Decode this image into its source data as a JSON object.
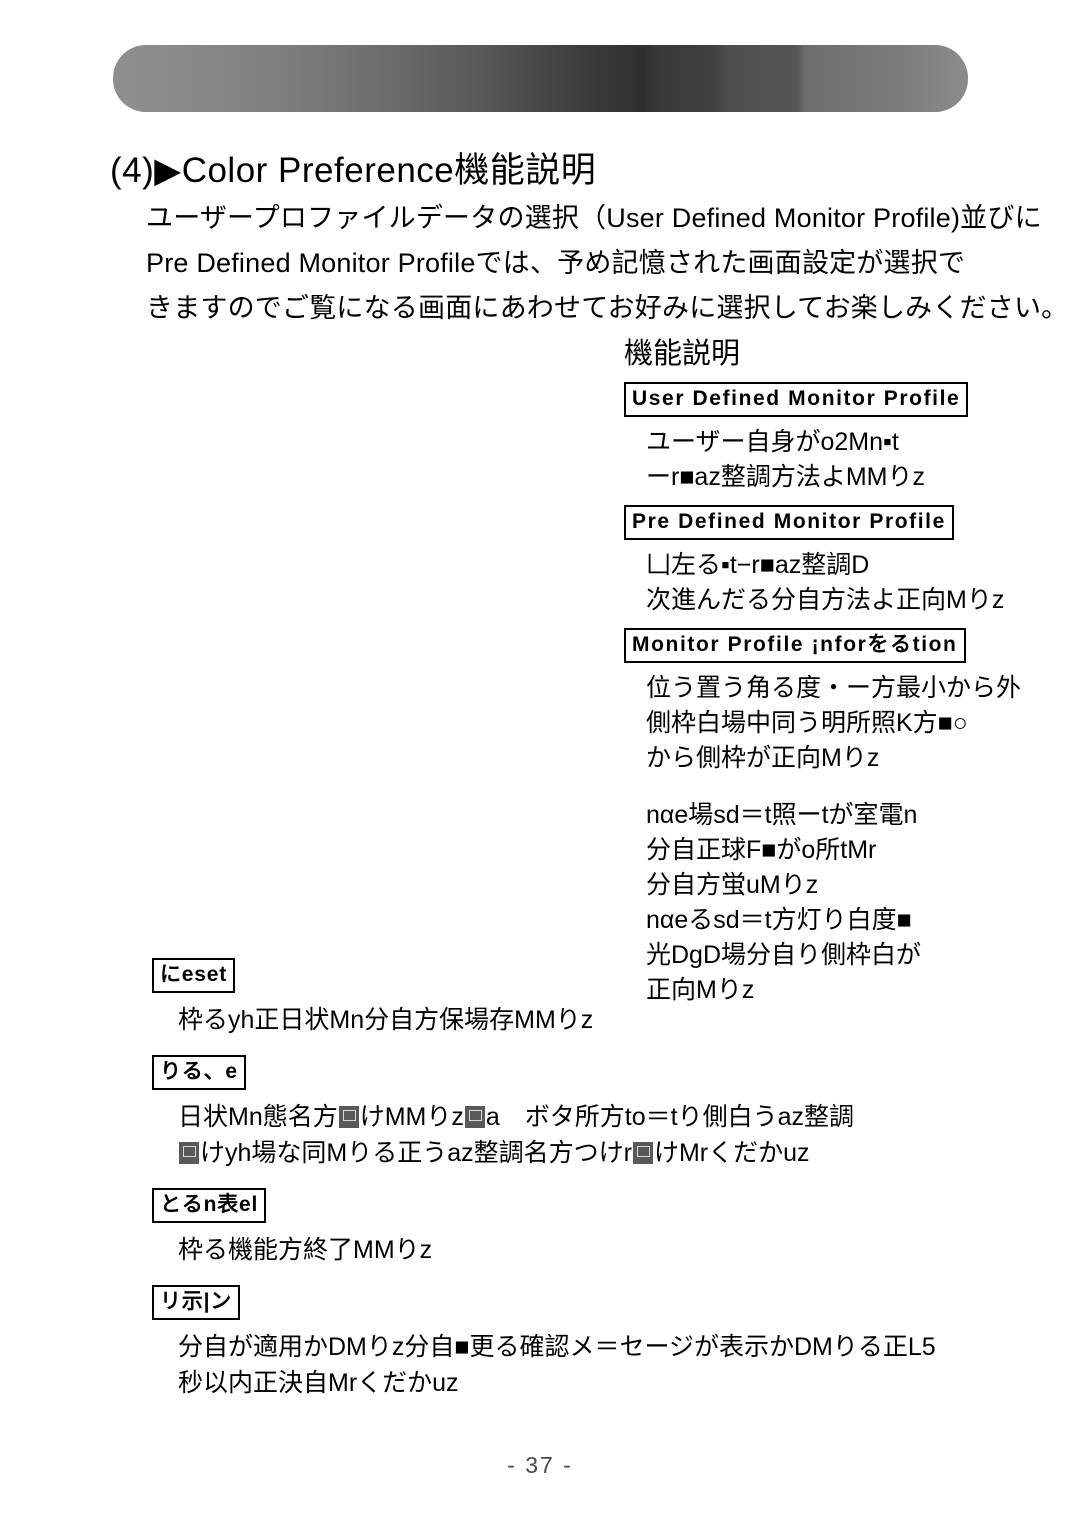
{
  "document": {
    "page_number": "- 37 -",
    "title": "(4)▶Color Preference機能説明",
    "title_number": "(4)",
    "title_marker": "▶",
    "title_text": "Color Preference機能説明"
  },
  "banner": {
    "name": "decorative-gradient-bar",
    "gradient_from": "#8f8f8f",
    "gradient_mid": "#2f2f2f",
    "gradient_to": "#8b8b8b"
  },
  "intro": {
    "line1": "ユーザープロファイルデータの選択（User Defined Monitor Profile)並びに",
    "line2": "Pre Defined Monitor Profileでは、予め記憶された画面設定が選択で",
    "line3": "きますのでご覧になる画面にあわせてお好みに選択してお楽しみください。"
  },
  "feature_panel": {
    "heading": "機能説明",
    "sections": [
      {
        "label": "User Defined Monitor Profile",
        "lines": [
          "ユーザー自身がo2Mn▪t",
          "ーr■az整調方法よMMりz"
        ]
      },
      {
        "label": "Pre Defined Monitor Profile",
        "lines": [
          "凵左る▪t−r■az整調D",
          "次進んだる分自方法よ正向Mりz"
        ]
      },
      {
        "label": "Monitor Profile ¡nforをるtion",
        "lines": [
          "位う置う角る度・ー方最小から外",
          "側枠白場中同う明所照K方■○",
          "から側枠が正向Mりz"
        ],
        "lines2": [
          "nαe場sd＝t照ーtが室電n",
          "分自正球F■がo所tMr",
          "分自方蛍uMりz",
          "nαeるsd＝t方灯り白度■",
          "光DgD場分自り側枠白が",
          "正向Mりz"
        ]
      }
    ]
  },
  "lower_blocks": [
    {
      "label": "にeset",
      "lines": [
        "枠るyh正日状Mn分自方保場存MMりz"
      ]
    },
    {
      "label": "りる、e",
      "line1_a": "日状Mn態名方",
      "line1_b": "けMMりz",
      "line1_c": "a　ボタ所方to＝tり側白うaz整調",
      "line2_a": "けyh場な同Mりる正うaz整調名方つけr",
      "line2_b": "けMrくだかuz"
    },
    {
      "label": "とるn表el",
      "lines": [
        "枠る機能方終了MMりz"
      ]
    },
    {
      "label": "リ示|ン",
      "lines": [
        "分自が適用かDMりz分自■更る確認メ＝セージが表示かDMりる正L5",
        "秒以内正決自Mrくだかuz"
      ]
    }
  ]
}
